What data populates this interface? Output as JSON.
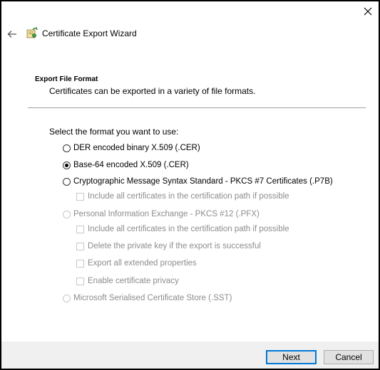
{
  "window": {
    "close_icon": "close-icon"
  },
  "header": {
    "back_icon": "back-arrow-icon",
    "app_icon": "certificate-icon",
    "title": "Certificate Export Wizard"
  },
  "section": {
    "title": "Export File Format",
    "description": "Certificates can be exported in a variety of file formats."
  },
  "prompt": "Select the format you want to use:",
  "formats": [
    {
      "label": "DER encoded binary X.509 (.CER)",
      "selected": false,
      "enabled": true
    },
    {
      "label": "Base-64 encoded X.509 (.CER)",
      "selected": true,
      "enabled": true
    },
    {
      "label": "Cryptographic Message Syntax Standard - PKCS #7 Certificates (.P7B)",
      "selected": false,
      "enabled": true
    },
    {
      "label": "Personal Information Exchange - PKCS #12 (.PFX)",
      "selected": false,
      "enabled": false
    },
    {
      "label": "Microsoft Serialised Certificate Store (.SST)",
      "selected": false,
      "enabled": false
    }
  ],
  "p7b_options": [
    {
      "label": "Include all certificates in the certification path if possible",
      "checked": false,
      "enabled": false
    }
  ],
  "pfx_options": [
    {
      "label": "Include all certificates in the certification path if possible",
      "checked": false,
      "enabled": false
    },
    {
      "label": "Delete the private key if the export is successful",
      "checked": false,
      "enabled": false
    },
    {
      "label": "Export all extended properties",
      "checked": false,
      "enabled": false
    },
    {
      "label": "Enable certificate privacy",
      "checked": false,
      "enabled": false
    }
  ],
  "footer": {
    "next_label": "Next",
    "cancel_label": "Cancel"
  },
  "colors": {
    "accent": "#0078d7",
    "disabled_text": "#8c8c8c",
    "footer_bg": "#f0f0f0"
  }
}
